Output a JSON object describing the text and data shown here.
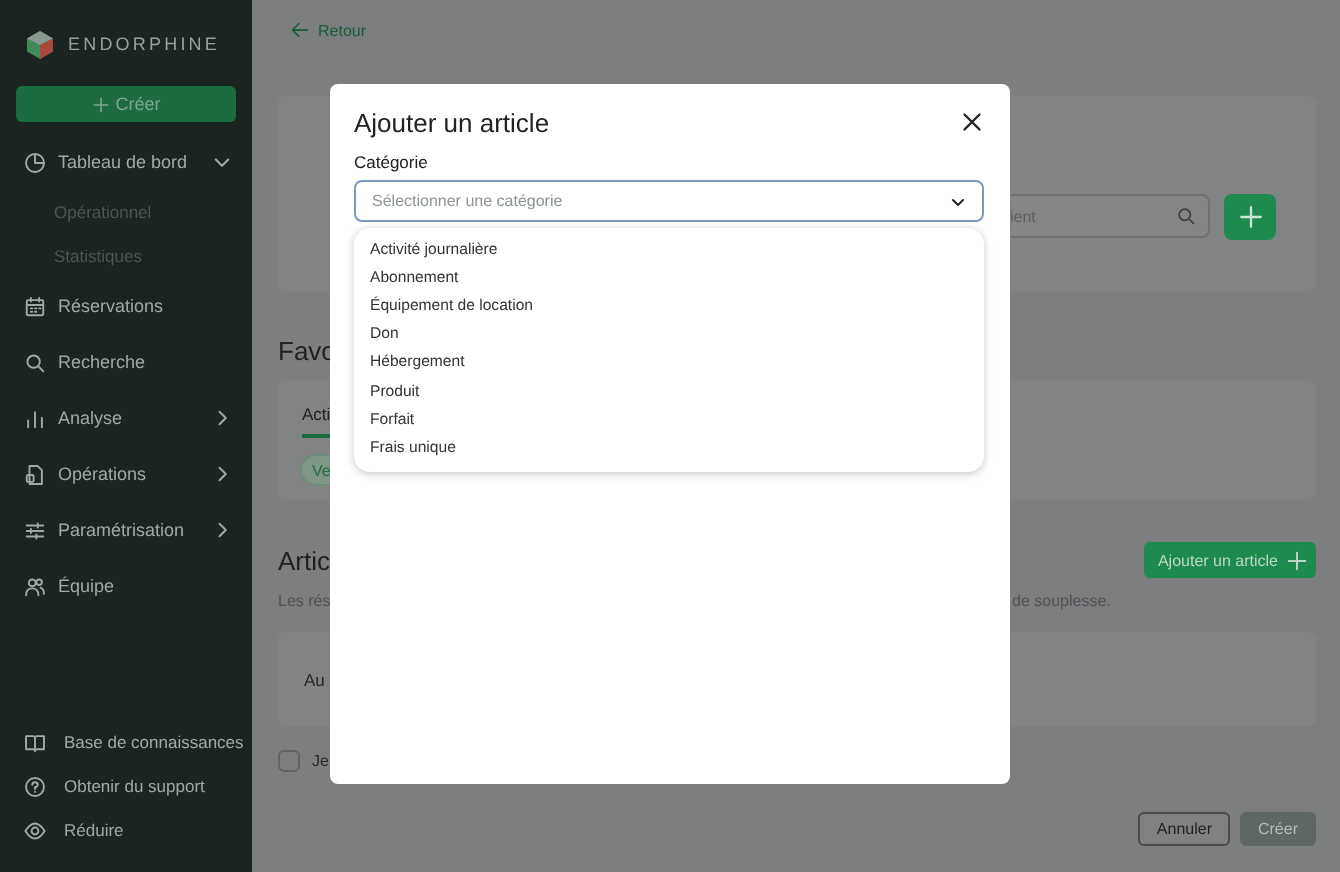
{
  "sidebar": {
    "brand": "ENDORPHINE",
    "create_button": {
      "label": "Créer"
    },
    "items": [
      {
        "label": "Tableau de bord",
        "expanded": true,
        "children": [
          {
            "label": "Opérationnel"
          },
          {
            "label": "Statistiques"
          }
        ]
      },
      {
        "label": "Réservations"
      },
      {
        "label": "Recherche"
      },
      {
        "label": "Analyse",
        "expanded": false
      },
      {
        "label": "Opérations",
        "expanded": false
      },
      {
        "label": "Paramétrisation",
        "expanded": false
      },
      {
        "label": "Équipe"
      }
    ],
    "footer_items": [
      {
        "label": "Base de connaissances"
      },
      {
        "label": "Obtenir du support"
      },
      {
        "label": "Réduire"
      }
    ]
  },
  "page": {
    "back_link": "Retour",
    "search": {
      "placeholder": "ient"
    },
    "favorites_heading": "Favo",
    "tabs": [
      {
        "label": "Acti",
        "selected": true
      }
    ],
    "chip": "Ve",
    "articles_heading": "Artic",
    "add_article_button": "Ajouter un article",
    "description_left": "Les rés",
    "description_right": "de souplesse.",
    "card_text": "Au",
    "checkbox": {
      "label": "Je",
      "checked": false
    },
    "footer_buttons": [
      {
        "label": "Annuler",
        "disabled": false
      },
      {
        "label": "Créer",
        "disabled": true
      }
    ]
  },
  "modal": {
    "title": "Ajouter un article",
    "field_label": "Catégorie",
    "select": {
      "placeholder": "Sélectionner une catégorie"
    },
    "options": [
      {
        "label": "Activité journalière"
      },
      {
        "label": "Abonnement"
      },
      {
        "label": "Équipement de location"
      },
      {
        "label": "Don"
      },
      {
        "label": "Hébergement"
      },
      {
        "label": "Produit"
      },
      {
        "label": "Forfait"
      },
      {
        "label": "Frais unique"
      }
    ]
  }
}
